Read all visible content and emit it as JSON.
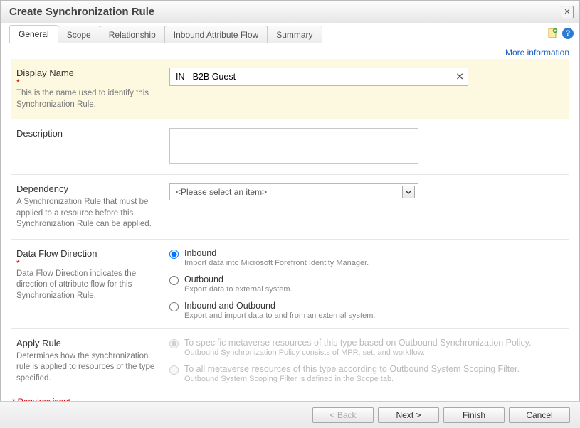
{
  "window": {
    "title": "Create Synchronization Rule"
  },
  "tabs": {
    "items": [
      {
        "label": "General"
      },
      {
        "label": "Scope"
      },
      {
        "label": "Relationship"
      },
      {
        "label": "Inbound Attribute Flow"
      },
      {
        "label": "Summary"
      }
    ]
  },
  "links": {
    "more_info": "More information"
  },
  "fields": {
    "displayName": {
      "label": "Display Name",
      "help": "This is the name used to identify this Synchronization Rule.",
      "value": "IN - B2B Guest"
    },
    "description": {
      "label": "Description",
      "value": ""
    },
    "dependency": {
      "label": "Dependency",
      "help": "A Synchronization Rule that must be applied to a resource before this Synchronization Rule can be applied.",
      "placeholder": "<Please select an item>"
    },
    "dataFlow": {
      "label": "Data Flow Direction",
      "help": "Data Flow Direction indicates the direction of attribute flow for this Synchronization Rule.",
      "options": {
        "inbound": {
          "label": "Inbound",
          "help": "Import data into Microsoft Forefront Identity Manager."
        },
        "outbound": {
          "label": "Outbound",
          "help": "Export data to external system."
        },
        "both": {
          "label": "Inbound and Outbound",
          "help": "Export and import data to and from an external system."
        }
      }
    },
    "applyRule": {
      "label": "Apply Rule",
      "help": "Determines how the synchronization rule is applied to resources of the type specified.",
      "options": {
        "policy": {
          "label": "To specific metaverse resources of this type based on Outbound Synchronization Policy.",
          "help": "Outbound Synchronization Policy consists of MPR, set, and workflow."
        },
        "filter": {
          "label": "To all metaverse resources of this type according to Outbound System Scoping Filter.",
          "help": "Outbound System Scoping Filter is defined in the Scope tab."
        }
      }
    }
  },
  "required_note": "* Requires input",
  "buttons": {
    "back": "< Back",
    "next": "Next >",
    "finish": "Finish",
    "cancel": "Cancel"
  }
}
